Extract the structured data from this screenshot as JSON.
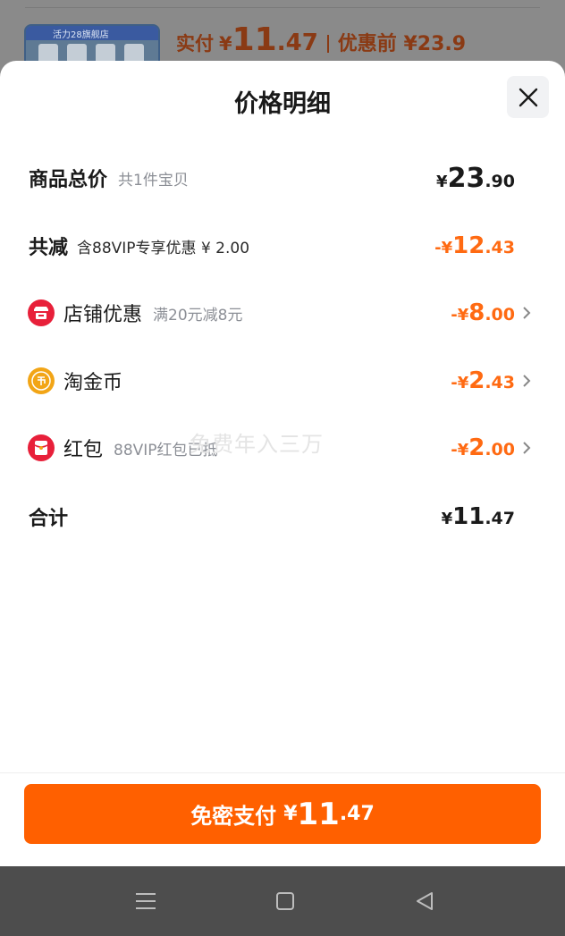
{
  "background": {
    "thumb_text": "活力28旗舰店",
    "paid_label": "实付",
    "paid_currency": "¥",
    "paid_int": "11",
    "paid_dec": ".47",
    "orig_text": "优惠前 ¥23.9"
  },
  "sheet": {
    "title": "价格明细",
    "close_icon": "close-icon"
  },
  "rows": {
    "total": {
      "label": "商品总价",
      "sub": "共1件宝贝",
      "currency": "¥",
      "int": "23",
      "dec": ".90"
    },
    "discount": {
      "label": "共减",
      "sub": "含88VIP专享优惠 ¥ 2.00",
      "currency": "-¥",
      "int": "12",
      "dec": ".43"
    },
    "shop": {
      "label": "店铺优惠",
      "sub": "满20元减8元",
      "currency": "-¥",
      "int": "8",
      "dec": ".00",
      "icon": "shop-icon"
    },
    "coin": {
      "label": "淘金币",
      "sub": "",
      "currency": "-¥",
      "int": "2",
      "dec": ".43",
      "icon": "coin-icon"
    },
    "redpacket": {
      "label": "红包",
      "sub": "88VIP红包已抵",
      "currency": "-¥",
      "int": "2",
      "dec": ".00",
      "icon": "red-packet-icon"
    },
    "sum": {
      "label": "合计",
      "currency": "¥",
      "int": "11",
      "dec": ".47"
    }
  },
  "watermark": "免费年入三万",
  "pay_button": {
    "label": "免密支付",
    "currency": "¥",
    "int": "11",
    "dec": ".47"
  },
  "navbar": {
    "menu_icon": "menu-icon",
    "home_icon": "home-icon",
    "back_icon": "back-icon"
  },
  "colors": {
    "accent": "#ff6000",
    "discount": "#ff6a12",
    "shop_icon": "#e8203a",
    "coin_icon": "#f2a516",
    "red_packet_icon": "#e8203a"
  }
}
